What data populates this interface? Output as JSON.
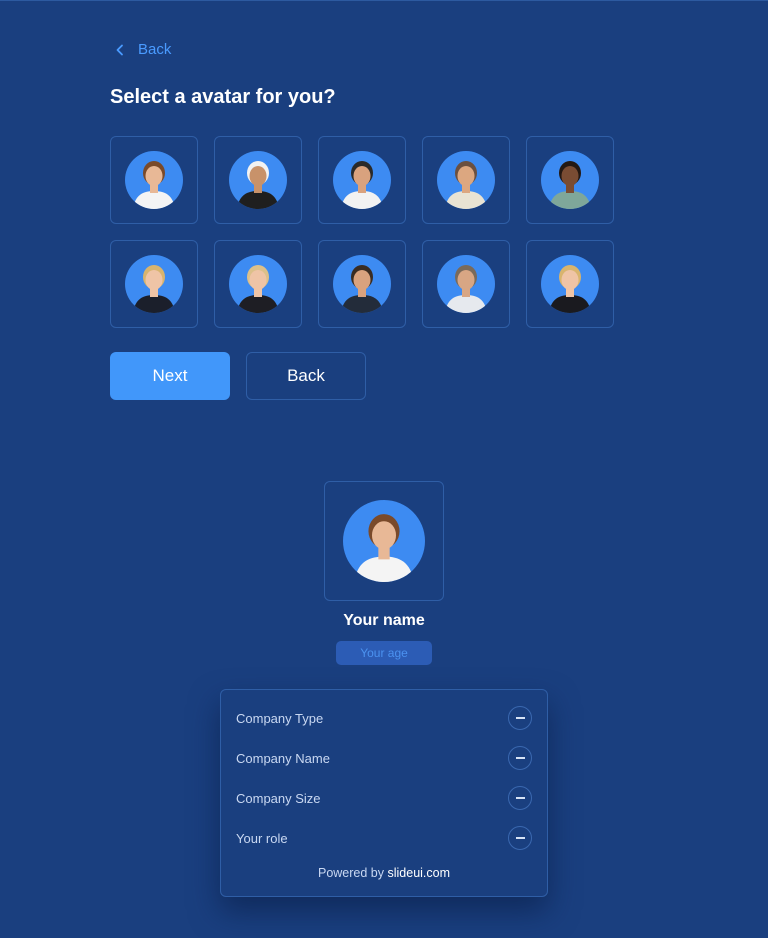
{
  "header": {
    "back_label": "Back",
    "title": "Select a avatar for you?"
  },
  "avatars": [
    {
      "name": "woman-glasses-white-shirt",
      "skin": "#e8b896",
      "hair": "#7a4a2a",
      "shirt": "#f4f4f4"
    },
    {
      "name": "bearded-man-cap",
      "skin": "#c8926a",
      "hair": "#f2f2f2",
      "shirt": "#1f1f1f"
    },
    {
      "name": "man-glasses-white-shirt",
      "skin": "#d9a27e",
      "hair": "#2a2a2a",
      "shirt": "#f2f2f2"
    },
    {
      "name": "man-arms-crossed",
      "skin": "#dca780",
      "hair": "#6b5040",
      "shirt": "#e9e3d3"
    },
    {
      "name": "woman-curly-hair",
      "skin": "#7a4c33",
      "hair": "#241812",
      "shirt": "#7fa79a"
    },
    {
      "name": "blonde-woman-suit",
      "skin": "#efc4a6",
      "hair": "#d8b46e",
      "shirt": "#1b1f2b"
    },
    {
      "name": "blonde-woman-blazer",
      "skin": "#efc4a6",
      "hair": "#dcc08a",
      "shirt": "#1e1e24"
    },
    {
      "name": "man-glasses-suit",
      "skin": "#d9a27e",
      "hair": "#3a2c22",
      "shirt": "#232c3a"
    },
    {
      "name": "man-tie",
      "skin": "#d8a684",
      "hair": "#7a6a5a",
      "shirt": "#e6e9ee"
    },
    {
      "name": "blonde-woman-black-blazer",
      "skin": "#efc4a6",
      "hair": "#d8b46e",
      "shirt": "#1a1a1f"
    }
  ],
  "actions": {
    "next_label": "Next",
    "back_label": "Back"
  },
  "profile": {
    "name": "Your name",
    "age_placeholder": "Your age"
  },
  "details": {
    "rows": [
      {
        "label": "Company Type"
      },
      {
        "label": "Company Name"
      },
      {
        "label": "Company Size"
      },
      {
        "label": "Your role"
      }
    ],
    "powered_prefix": "Powered by",
    "powered_brand": "slideui.com"
  },
  "colors": {
    "background": "#1a3f7f",
    "accent": "#4197fa",
    "avatar_circle": "#3d8bf2",
    "border": "#2f5ea6"
  },
  "icons": {
    "back": "chevron-left-icon",
    "row_action": "minus-circle-icon"
  }
}
